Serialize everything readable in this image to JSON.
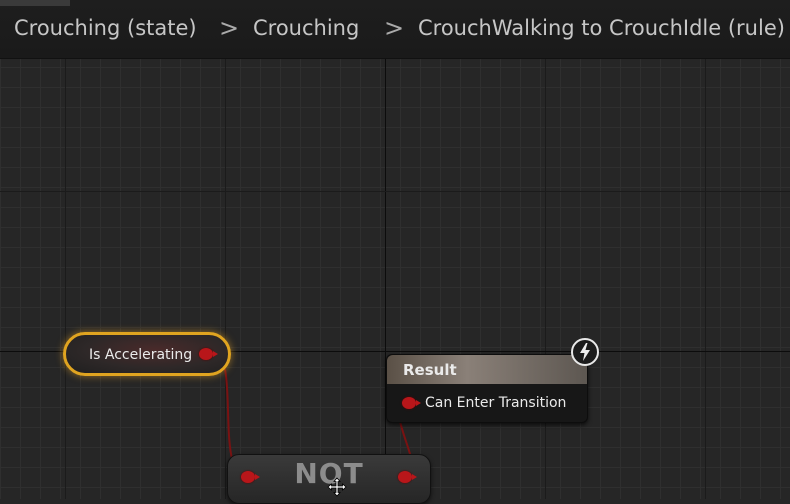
{
  "breadcrumb": {
    "items": [
      "Crouching (state)",
      "Crouching",
      "CrouchWalking to CrouchIdle (rule)"
    ],
    "separator": ">"
  },
  "nodes": {
    "is_accelerating": {
      "label": "Is Accelerating"
    },
    "result": {
      "title": "Result",
      "pin_label": "Can Enter Transition"
    },
    "not": {
      "title": "NOT"
    }
  },
  "colors": {
    "graph_bg": "#262626",
    "bool_pin": "#b8161a",
    "selected_outline": "#e0a420"
  },
  "icons": [
    "chevron-right-icon",
    "lightning-bolt-icon",
    "move-cursor-icon"
  ]
}
